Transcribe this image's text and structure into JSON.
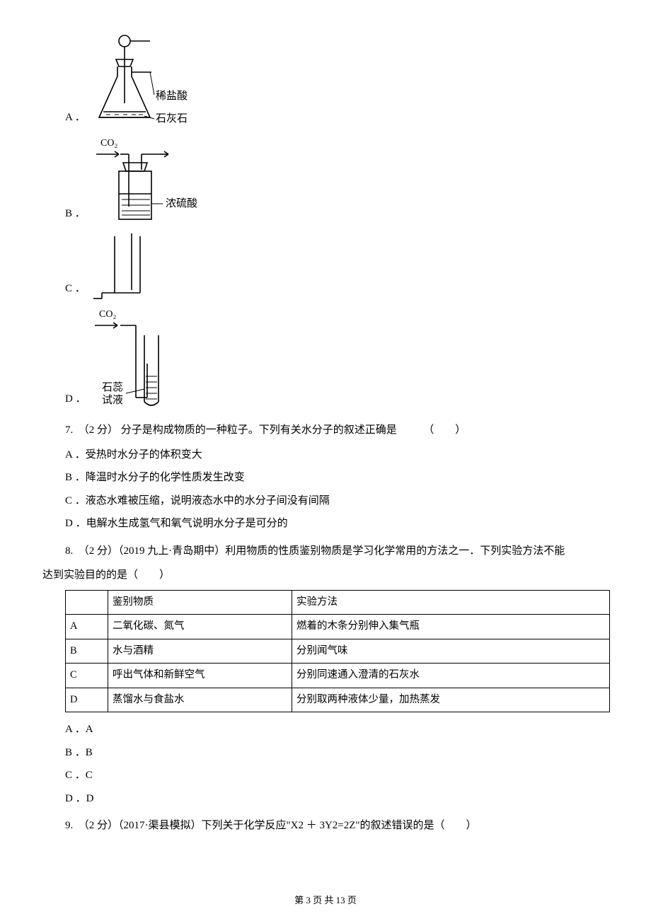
{
  "option_A": {
    "label": "A ．",
    "annot1": "稀盐酸",
    "annot2": "石灰石"
  },
  "option_B": {
    "label": "B ．",
    "gas": "CO₂",
    "annot": "浓硫酸"
  },
  "option_C": {
    "label": "C ．"
  },
  "option_D": {
    "label": "D ．",
    "gas": "CO₂",
    "annot1": "石蕊",
    "annot2": "试液"
  },
  "q7": {
    "stem": "7.　（2 分）  分子是构成物质的一种粒子。下列有关水分子的叙述正确是　　　（　　）",
    "A": "A ．受热时水分子的体积变大",
    "B": "B ．降温时水分子的化学性质发生改变",
    "C": "C ．液态水难被压缩，说明液态水中的水分子间没有间隔",
    "D": "D ．电解水生成氢气和氧气说明水分子是可分的"
  },
  "q8": {
    "stem_1": "8.　（2 分）（2019 九上·青岛期中）利用物质的性质鉴别物质是学习化学常用的方法之一．下列实验方法不能",
    "stem_2": "达到实验目的的是（　　）",
    "table": {
      "h1": "",
      "h2": "鉴别物质",
      "h3": "实验方法",
      "r1c1": "A",
      "r1c2": "二氧化碳、氮气",
      "r1c3": "燃着的木条分别伸入集气瓶",
      "r2c1": "B",
      "r2c2": "水与酒精",
      "r2c3": "分别闻气味",
      "r3c1": "C",
      "r3c2": "呼出气体和新鲜空气",
      "r3c3": "分别同速通入澄清的石灰水",
      "r4c1": "D",
      "r4c2": "蒸馏水与食盐水",
      "r4c3": "分别取两种液体少量，加热蒸发"
    },
    "A": "A ．A",
    "B": "B ．B",
    "C": "C ．C",
    "D": "D ．D"
  },
  "q9": {
    "stem": "9.　（2 分）（2017·渠县模拟）下列关于化学反应\"X2 ＋ 3Y2=2Z\"的叙述错误的是（　　）"
  },
  "footer": "第 3 页 共 13 页"
}
